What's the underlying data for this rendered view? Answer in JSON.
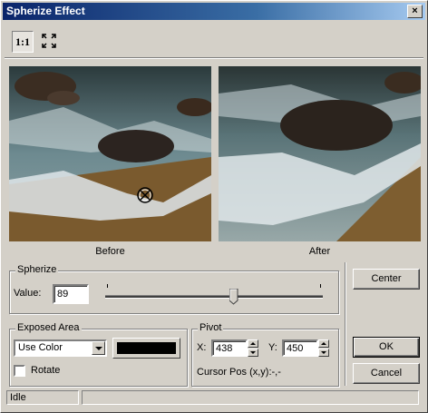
{
  "window": {
    "title": "Spherize Effect",
    "close_label": "×"
  },
  "toolbar": {
    "actual_size_label": "1:1",
    "fit_icon": "fit-to-window-icon"
  },
  "preview": {
    "before_label": "Before",
    "after_label": "After",
    "target_icon": "crosshair-target-icon"
  },
  "spherize": {
    "legend": "Spherize",
    "value_label": "Value:",
    "value": "89"
  },
  "exposed_area": {
    "legend": "Exposed Area",
    "mode": "Use Color",
    "swatch_color": "#000000",
    "rotate_label": "Rotate",
    "rotate_checked": false
  },
  "pivot": {
    "legend": "Pivot",
    "x_label": "X:",
    "x_value": "438",
    "y_label": "Y:",
    "y_value": "450",
    "cursor_pos": "Cursor Pos (x,y):-,-"
  },
  "buttons": {
    "center": "Center",
    "ok": "OK",
    "cancel": "Cancel"
  },
  "status": {
    "state": "Idle",
    "message": ""
  }
}
